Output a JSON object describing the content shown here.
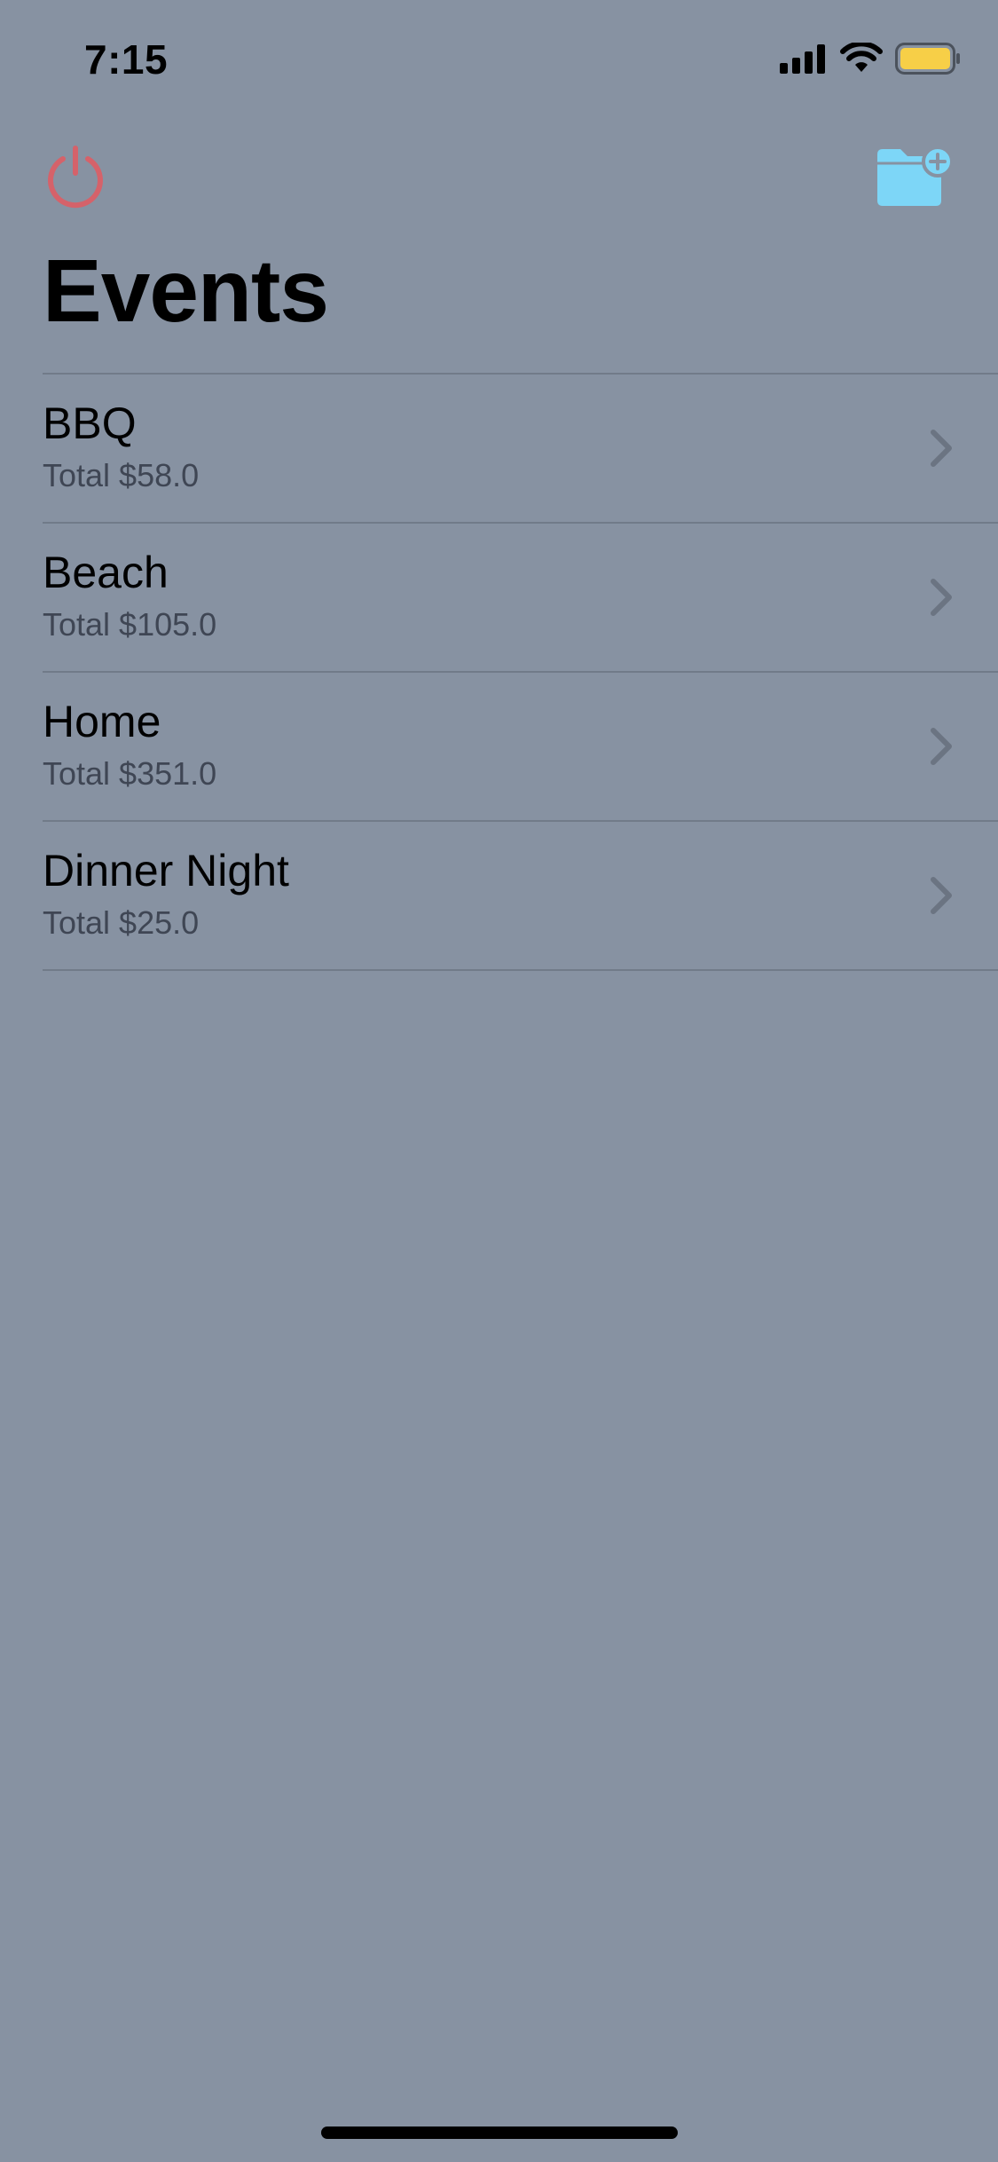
{
  "status_bar": {
    "time": "7:15",
    "signal_icon": "cellular-signal-icon",
    "wifi_icon": "wifi-icon",
    "battery_icon": "battery-icon",
    "battery_color": "#f7cf47"
  },
  "nav": {
    "left_icon": "power-icon",
    "left_icon_color": "#d5626a",
    "right_icon": "folder-add-icon",
    "right_icon_color": "#7dd6f7"
  },
  "title": "Events",
  "events": [
    {
      "name": "BBQ",
      "total": "Total $58.0"
    },
    {
      "name": "Beach",
      "total": "Total $105.0"
    },
    {
      "name": "Home",
      "total": "Total $351.0"
    },
    {
      "name": "Dinner Night",
      "total": "Total $25.0"
    }
  ],
  "colors": {
    "background": "#8792a2",
    "separator": "#717b89",
    "secondary_text": "#3f4654",
    "chevron": "#6b7482"
  }
}
